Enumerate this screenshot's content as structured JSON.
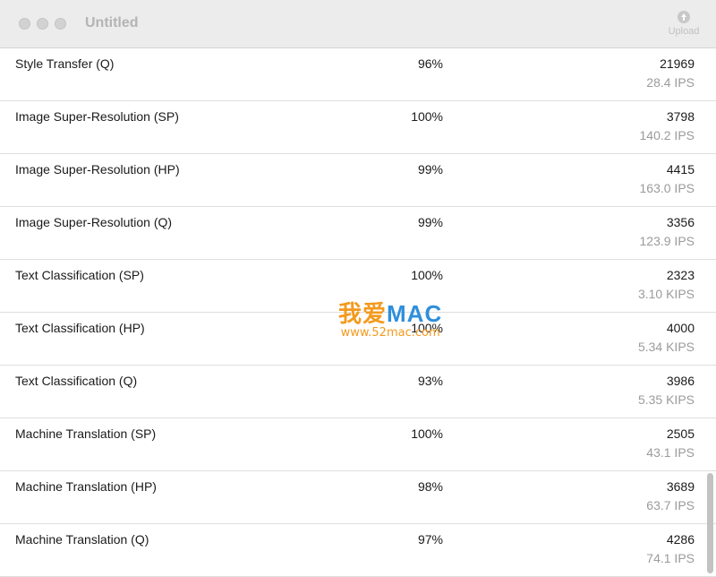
{
  "window": {
    "title": "Untitled",
    "upload_label": "Upload"
  },
  "rows": [
    {
      "name": "Style Transfer (Q)",
      "percent": "96%",
      "score": "21969",
      "rate": "28.4 IPS"
    },
    {
      "name": "Image Super-Resolution (SP)",
      "percent": "100%",
      "score": "3798",
      "rate": "140.2 IPS"
    },
    {
      "name": "Image Super-Resolution (HP)",
      "percent": "99%",
      "score": "4415",
      "rate": "163.0 IPS"
    },
    {
      "name": "Image Super-Resolution (Q)",
      "percent": "99%",
      "score": "3356",
      "rate": "123.9 IPS"
    },
    {
      "name": "Text Classification (SP)",
      "percent": "100%",
      "score": "2323",
      "rate": "3.10 KIPS"
    },
    {
      "name": "Text Classification (HP)",
      "percent": "100%",
      "score": "4000",
      "rate": "5.34 KIPS"
    },
    {
      "name": "Text Classification (Q)",
      "percent": "93%",
      "score": "3986",
      "rate": "5.35 KIPS"
    },
    {
      "name": "Machine Translation (SP)",
      "percent": "100%",
      "score": "2505",
      "rate": "43.1 IPS"
    },
    {
      "name": "Machine Translation (HP)",
      "percent": "98%",
      "score": "3689",
      "rate": "63.7 IPS"
    },
    {
      "name": "Machine Translation (Q)",
      "percent": "97%",
      "score": "4286",
      "rate": "74.1 IPS"
    }
  ],
  "watermark": {
    "logo_cn": "我爱",
    "logo_mac": "MAC",
    "url": "www.52mac.com"
  },
  "icons": {
    "upload": "upload-arrow-icon"
  }
}
